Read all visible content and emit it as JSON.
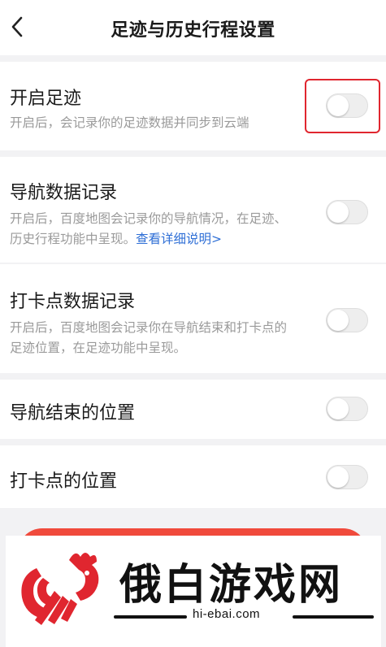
{
  "header": {
    "title": "足迹与历史行程设置"
  },
  "settings": [
    {
      "title": "开启足迹",
      "desc": "开启后，会记录你的足迹数据并同步到云端",
      "enabled": false
    },
    {
      "title": "导航数据记录",
      "desc": "开启后，百度地图会记录你的导航情况，在足迹、历史行程功能中呈现。",
      "link": "查看详细说明>",
      "enabled": false
    },
    {
      "title": "打卡点数据记录",
      "desc": "开启后，百度地图会记录你在导航结束和打卡点的足迹位置，在足迹功能中呈现。",
      "enabled": false
    },
    {
      "title": "导航结束的位置",
      "enabled": false
    },
    {
      "title": "打卡点的位置",
      "enabled": false
    }
  ],
  "colors": {
    "highlight": "#e0262f",
    "link": "#2f6fd6",
    "button": "#f04a3c"
  },
  "watermark": {
    "text": "俄白游戏网",
    "url": "hi-ebai.com"
  }
}
